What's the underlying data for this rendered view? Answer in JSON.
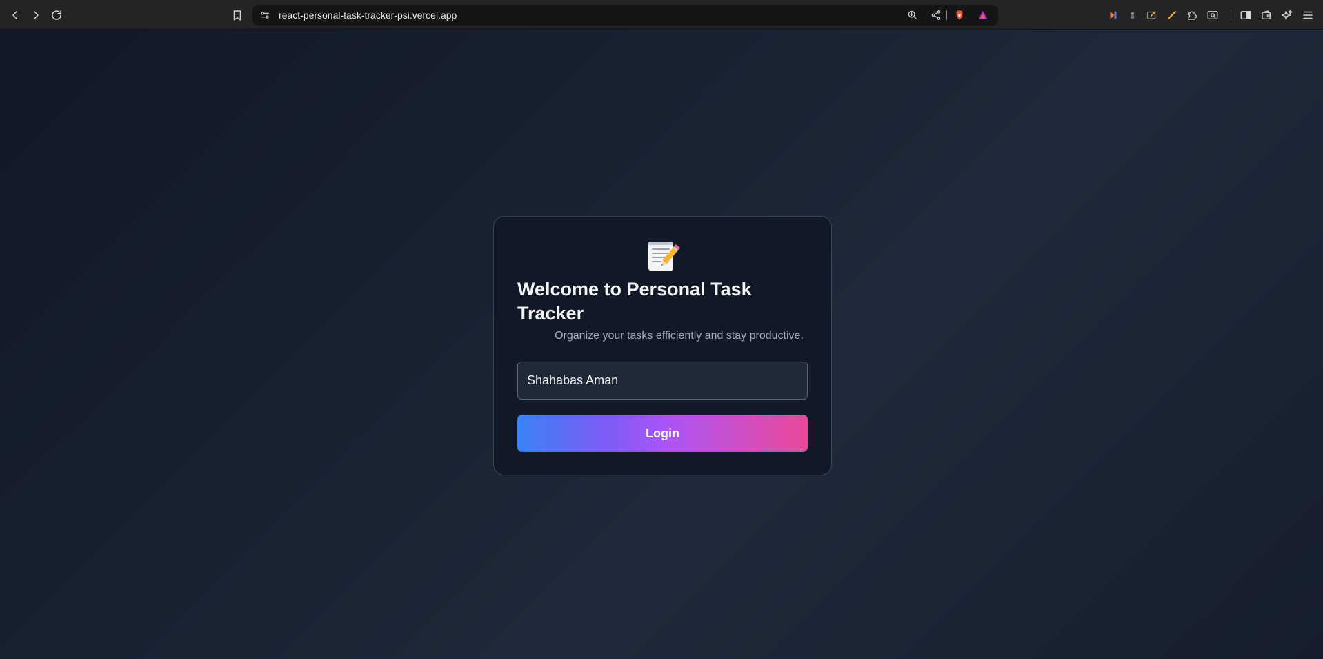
{
  "browser": {
    "url": "react-personal-task-tracker-psi.vercel.app",
    "nav_icons": [
      "back-icon",
      "forward-icon",
      "reload-icon",
      "bookmark-icon"
    ],
    "url_icons": [
      "site-settings-icon",
      "zoom-icon",
      "share-icon",
      "brave-shields-icon",
      "brave-rewards-icon"
    ],
    "extension_icons": [
      "extension-a-icon",
      "extension-b-icon",
      "extension-c-icon",
      "extension-d-icon",
      "extensions-puzzle-icon",
      "screenshot-icon",
      "sidebar-icon",
      "wallet-icon",
      "leo-ai-icon",
      "menu-icon"
    ]
  },
  "login": {
    "emoji": "memo-icon",
    "title": "Welcome to Personal Task Tracker",
    "subtitle": "Organize your tasks efficiently and stay productive.",
    "name_value": "Shahabas Aman",
    "button_label": "Login"
  },
  "colors": {
    "page_bg": "#1a2433",
    "card_bg": "#111827",
    "input_bg": "#1f2937",
    "gradient_start": "#3b82f6",
    "gradient_end": "#ec4899"
  }
}
